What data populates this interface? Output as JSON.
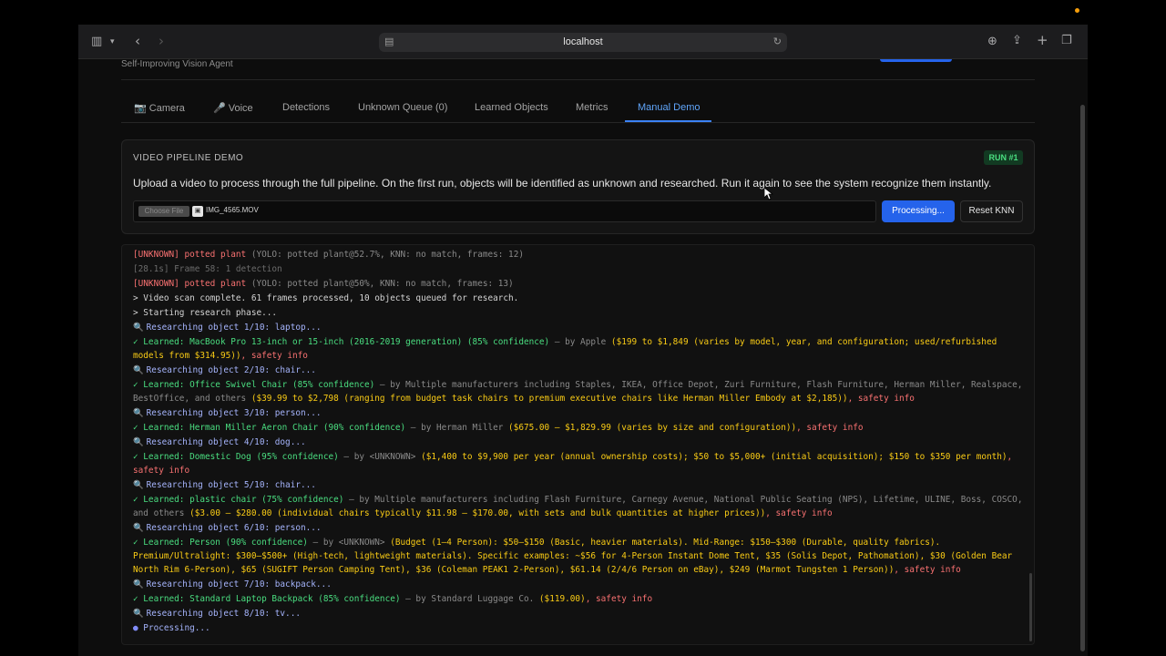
{
  "browser": {
    "url": "localhost"
  },
  "app": {
    "subtitle": "Self-Improving Vision Agent"
  },
  "tabs": [
    {
      "label": "📷 Camera"
    },
    {
      "label": "🎤 Voice"
    },
    {
      "label": "Detections"
    },
    {
      "label": "Unknown Queue (0)"
    },
    {
      "label": "Learned Objects"
    },
    {
      "label": "Metrics"
    },
    {
      "label": "Manual Demo"
    }
  ],
  "demo": {
    "title": "VIDEO PIPELINE DEMO",
    "badge": "RUN #1",
    "description": "Upload a video to process through the full pipeline. On the first run, objects will be identified as unknown and researched. Run it again to see the system recognize them instantly.",
    "choose_file": "Choose File",
    "file_name": "IMG_4565.MOV",
    "processing_label": "Processing...",
    "reset_label": "Reset KNN"
  },
  "log": [
    {
      "segments": [
        {
          "t": "[UNKNOWN]",
          "c": "red"
        },
        {
          "t": " potted plant ",
          "c": "red"
        },
        {
          "t": "(YOLO: potted plant@52.7%, KNN: no match, frames: 12)",
          "c": "grey"
        }
      ]
    },
    {
      "segments": [
        {
          "t": "[28.1s] Frame 58: 1 detection",
          "c": "dgrey"
        }
      ]
    },
    {
      "segments": [
        {
          "t": "[UNKNOWN]",
          "c": "red"
        },
        {
          "t": " potted plant ",
          "c": "red"
        },
        {
          "t": "(YOLO: potted plant@50%, KNN: no match, frames: 13)",
          "c": "grey"
        }
      ]
    },
    {
      "segments": [
        {
          "t": "> Video scan complete. 61 frames processed, 10 objects queued for research.",
          "c": "white"
        }
      ]
    },
    {
      "segments": [
        {
          "t": "> Starting research phase...",
          "c": "white"
        }
      ]
    },
    {
      "segments": [
        {
          "t": "🔍 ",
          "c": "mag"
        },
        {
          "t": "Researching object 1/10: laptop...",
          "c": "purple"
        }
      ]
    },
    {
      "segments": [
        {
          "t": "✓ Learned: MacBook Pro 13-inch or 15-inch (2016-2019 generation) (85% confidence)",
          "c": "green"
        },
        {
          "t": " — by Apple ",
          "c": "grey"
        },
        {
          "t": "($199 to $1,849 (varies by model, year, and configuration; used/refurbished models from $314.95))",
          "c": "yellow"
        },
        {
          "t": ", safety info",
          "c": "red"
        }
      ]
    },
    {
      "segments": [
        {
          "t": "🔍 ",
          "c": "mag"
        },
        {
          "t": "Researching object 2/10: chair...",
          "c": "purple"
        }
      ]
    },
    {
      "segments": [
        {
          "t": "✓ Learned: Office Swivel Chair (85% confidence)",
          "c": "green"
        },
        {
          "t": " — by Multiple manufacturers including Staples, IKEA, Office Depot, Zuri Furniture, Flash Furniture, Herman Miller, Realspace, BestOffice, and others ",
          "c": "grey"
        },
        {
          "t": "($39.99 to $2,798 (ranging from budget task chairs to premium executive chairs like Herman Miller Embody at $2,185))",
          "c": "yellow"
        },
        {
          "t": ", safety info",
          "c": "red"
        }
      ]
    },
    {
      "segments": [
        {
          "t": "🔍 ",
          "c": "mag"
        },
        {
          "t": "Researching object 3/10: person...",
          "c": "purple"
        }
      ]
    },
    {
      "segments": [
        {
          "t": "✓ Learned: Herman Miller Aeron Chair (90% confidence)",
          "c": "green"
        },
        {
          "t": " — by Herman Miller ",
          "c": "grey"
        },
        {
          "t": "($675.00 – $1,829.99 (varies by size and configuration))",
          "c": "yellow"
        },
        {
          "t": ", safety info",
          "c": "red"
        }
      ]
    },
    {
      "segments": [
        {
          "t": "🔍 ",
          "c": "mag"
        },
        {
          "t": "Researching object 4/10: dog...",
          "c": "purple"
        }
      ]
    },
    {
      "segments": [
        {
          "t": "✓ Learned: Domestic Dog (95% confidence)",
          "c": "green"
        },
        {
          "t": " — by <UNKNOWN> ",
          "c": "grey"
        },
        {
          "t": "($1,400 to $9,900 per year (annual ownership costs); $50 to $5,000+ (initial acquisition); $150 to $350 per month)",
          "c": "yellow"
        },
        {
          "t": ", safety info",
          "c": "red"
        }
      ]
    },
    {
      "segments": [
        {
          "t": "🔍 ",
          "c": "mag"
        },
        {
          "t": "Researching object 5/10: chair...",
          "c": "purple"
        }
      ]
    },
    {
      "segments": [
        {
          "t": "✓ Learned: plastic chair (75% confidence)",
          "c": "green"
        },
        {
          "t": " — by Multiple manufacturers including Flash Furniture, Carnegy Avenue, National Public Seating (NPS), Lifetime, ULINE, Boss, COSCO, and others ",
          "c": "grey"
        },
        {
          "t": "($3.00 – $280.00 (individual chairs typically $11.98 – $170.00, with sets and bulk quantities at higher prices))",
          "c": "yellow"
        },
        {
          "t": ", safety info",
          "c": "red"
        }
      ]
    },
    {
      "segments": [
        {
          "t": "🔍 ",
          "c": "mag"
        },
        {
          "t": "Researching object 6/10: person...",
          "c": "purple"
        }
      ]
    },
    {
      "segments": [
        {
          "t": "✓ Learned: Person (90% confidence)",
          "c": "green"
        },
        {
          "t": " — by <UNKNOWN> ",
          "c": "grey"
        },
        {
          "t": "(Budget (1–4 Person): $50–$150 (Basic, heavier materials). Mid-Range: $150–$300 (Durable, quality fabrics). Premium/Ultralight: $300–$500+ (High-tech, lightweight materials). Specific examples: ~$56 for 4-Person Instant Dome Tent, $35 (Solis Depot, Pathomation), $30 (Golden Bear North Rim 6-Person), $65 (SUGIFT Person Camping Tent), $36 (Coleman PEAK1 2-Person), $61.14 (2/4/6 Person on eBay), $249 (Marmot Tungsten 1 Person))",
          "c": "yellow"
        },
        {
          "t": ", safety info",
          "c": "red"
        }
      ]
    },
    {
      "segments": [
        {
          "t": "🔍 ",
          "c": "mag"
        },
        {
          "t": "Researching object 7/10: backpack...",
          "c": "purple"
        }
      ]
    },
    {
      "segments": [
        {
          "t": "✓ Learned: Standard Laptop Backpack (85% confidence)",
          "c": "green"
        },
        {
          "t": " — by Standard Luggage Co. ",
          "c": "grey"
        },
        {
          "t": "($119.00)",
          "c": "yellow"
        },
        {
          "t": ", safety info",
          "c": "red"
        }
      ]
    },
    {
      "segments": [
        {
          "t": "🔍 ",
          "c": "mag"
        },
        {
          "t": "Researching object 8/10: tv...",
          "c": "purple"
        }
      ]
    },
    {
      "segments": [
        {
          "t": "● ",
          "c": "blue"
        },
        {
          "t": "Processing...",
          "c": "purple"
        }
      ]
    }
  ]
}
